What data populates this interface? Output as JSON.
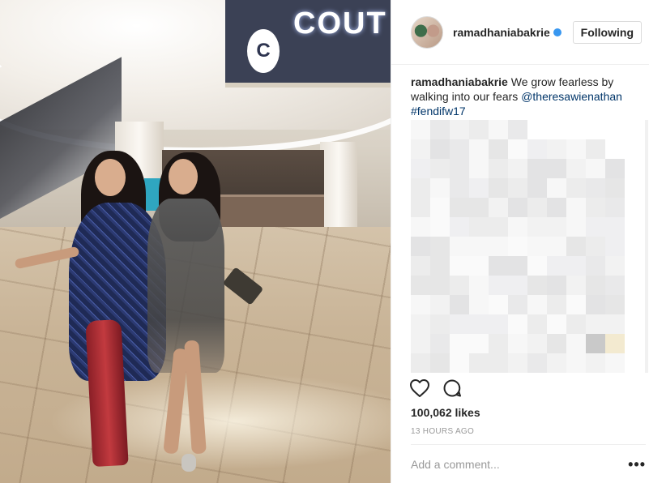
{
  "post": {
    "username": "ramadhaniabakrie",
    "follow_label": "Following",
    "caption_text": " We grow fearless by walking into our fears ",
    "caption_mention": "@theresawienathan",
    "caption_hashtag": "#fendifw17",
    "likes": "100,062 likes",
    "timestamp": "13 HOURS AGO",
    "comment_placeholder": "Add a comment...",
    "more_label": "•••"
  },
  "photo": {
    "store_sign_text": "COUT",
    "store_logo_letter": "C"
  },
  "icons": [
    "heart-icon",
    "comment-icon",
    "verified-badge-icon",
    "more-options-icon"
  ],
  "colors": {
    "link": "#003569",
    "verified": "#3897f0",
    "border": "#efefef",
    "muted": "#999999"
  }
}
